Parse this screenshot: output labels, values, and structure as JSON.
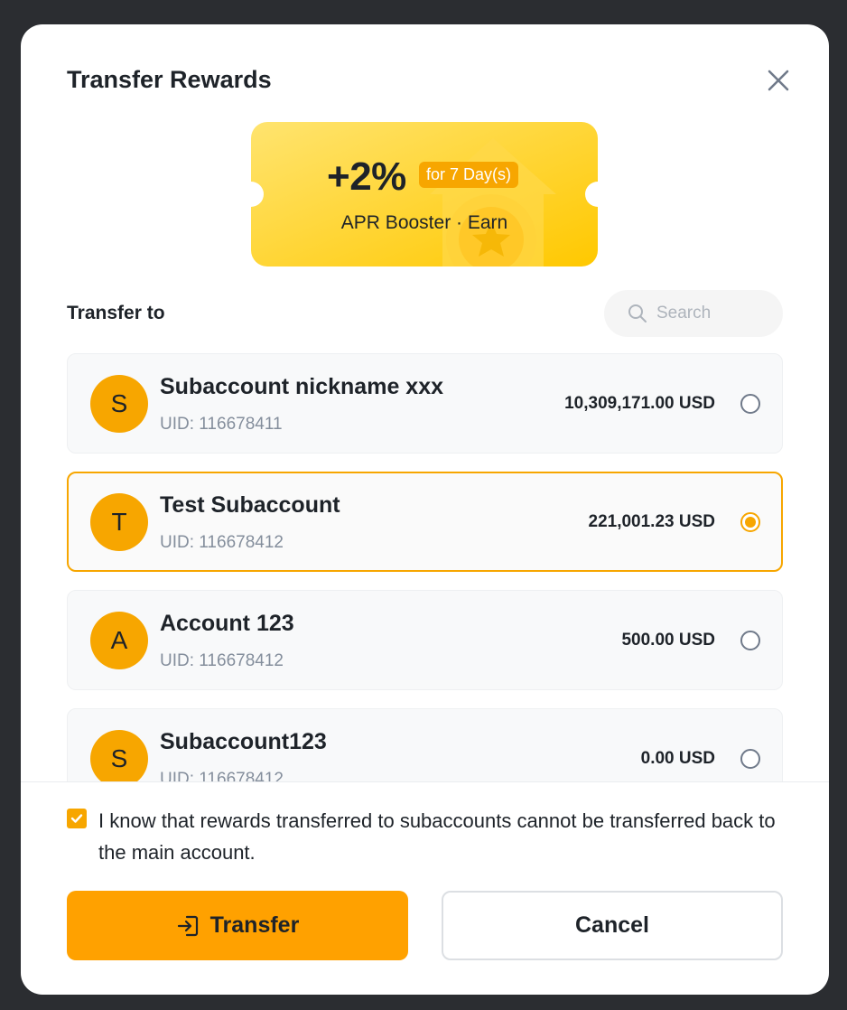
{
  "modal": {
    "title": "Transfer Rewards"
  },
  "coupon": {
    "percent": "+2%",
    "duration_tag": "for 7 Day(s)",
    "subtitle": "APR Booster · Earn"
  },
  "transfer": {
    "label": "Transfer to",
    "search_placeholder": "Search"
  },
  "accounts": [
    {
      "initial": "S",
      "name": "Subaccount nickname xxx",
      "uid": "UID: 116678411",
      "balance": "10,309,171.00 USD",
      "selected": false
    },
    {
      "initial": "T",
      "name": "Test Subaccount",
      "uid": "UID: 116678412",
      "balance": "221,001.23 USD",
      "selected": true
    },
    {
      "initial": "A",
      "name": "Account 123",
      "uid": "UID: 116678412",
      "balance": "500.00 USD",
      "selected": false
    },
    {
      "initial": "S",
      "name": "Subaccount123",
      "uid": "UID: 116678412",
      "balance": "0.00 USD",
      "selected": false
    }
  ],
  "acknowledgement": {
    "checked": true,
    "text": "I know that rewards transferred to subaccounts cannot be transferred back to the main account."
  },
  "buttons": {
    "transfer_label": "Transfer",
    "cancel_label": "Cancel"
  },
  "colors": {
    "accent": "#f7a600",
    "coupon_light": "#ffe26b",
    "coupon_dark": "#ffc800",
    "overlay": "#2b2d31"
  }
}
